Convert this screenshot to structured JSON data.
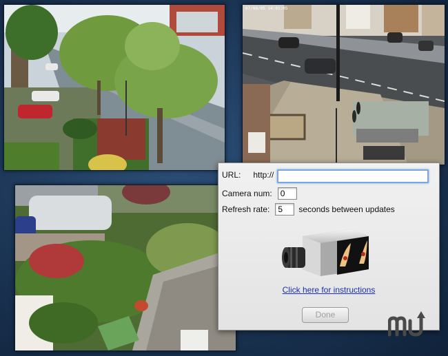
{
  "cameras": {
    "cam2_timestamp": "07/08/05 14:01:05"
  },
  "dialog": {
    "url_label": "URL:",
    "url_prefix": "http://",
    "url_value": "",
    "camera_num_label": "Camera num:",
    "camera_num_value": "0",
    "refresh_label": "Refresh rate:",
    "refresh_value": "5",
    "refresh_suffix": "seconds between updates",
    "camera_icon": "webcam-icon",
    "instructions_link": "Click here for instructions",
    "done_label": "Done"
  },
  "branding": {
    "logo_icon": "macupdate-logo-icon"
  },
  "colors": {
    "background": "#1e3a5c",
    "link": "#1a2fb0",
    "focus_ring": "#7aa7e0"
  }
}
